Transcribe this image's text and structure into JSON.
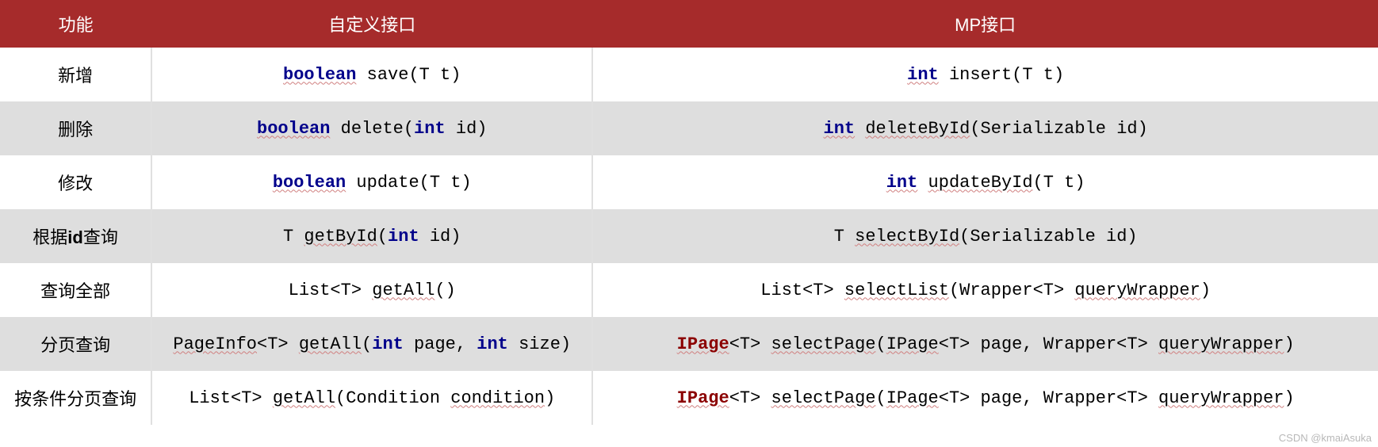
{
  "headers": {
    "col1": "功能",
    "col2": "自定义接口",
    "col3": "MP接口"
  },
  "rows": [
    {
      "feature": "新增",
      "custom": {
        "frag1": "boolean",
        "frag2": " save(T t)"
      },
      "mp": {
        "frag1": "int",
        "frag2": " insert(T t)"
      }
    },
    {
      "feature": "删除",
      "custom": {
        "frag1": "boolean",
        "frag2": " delete(",
        "frag3": "int",
        "frag4": " id)"
      },
      "mp": {
        "frag1": "int",
        "frag2": " ",
        "frag3": "deleteById",
        "frag4": "(Serializable id)"
      }
    },
    {
      "feature": "修改",
      "custom": {
        "frag1": "boolean",
        "frag2": " update(T t)"
      },
      "mp": {
        "frag1": "int",
        "frag2": " ",
        "frag3": "updateById",
        "frag4": "(T t)"
      }
    },
    {
      "feature_prefix": "根据",
      "feature_bold": "id",
      "feature_suffix": "查询",
      "custom": {
        "frag1": "T ",
        "frag2": "getById",
        "frag3": "(",
        "frag4": "int",
        "frag5": " id)"
      },
      "mp": {
        "frag1": "T ",
        "frag2": "selectById",
        "frag3": "(Serializable id)"
      }
    },
    {
      "feature": "查询全部",
      "custom": {
        "frag1": "List<T> ",
        "frag2": "getAll",
        "frag3": "()"
      },
      "mp": {
        "frag1": "List<T> ",
        "frag2": "selectList",
        "frag3": "(Wrapper<T> ",
        "frag4": "queryWrapper",
        "frag5": ")"
      }
    },
    {
      "feature": "分页查询",
      "custom": {
        "frag1": "PageInfo",
        "frag2": "<T> ",
        "frag3": "getAll",
        "frag4": "(",
        "frag5": "int",
        "frag6": " page, ",
        "frag7": "int",
        "frag8": " size)"
      },
      "mp": {
        "frag1": "IPage",
        "frag2": "<T> ",
        "frag3": "selectPage",
        "frag4": "(",
        "frag5": "IPage",
        "frag6": "<T> page, Wrapper<T> ",
        "frag7": "queryWrapper",
        "frag8": ")"
      }
    },
    {
      "feature": "按条件分页查询",
      "custom": {
        "frag1": "List<T> ",
        "frag2": "getAll",
        "frag3": "(Condition ",
        "frag4": "condition",
        "frag5": ")"
      },
      "mp": {
        "frag1": "IPage",
        "frag2": "<T> ",
        "frag3": "selectPage",
        "frag4": "(",
        "frag5": "IPage",
        "frag6": "<T> page, Wrapper<T> ",
        "frag7": "queryWrapper",
        "frag8": ")"
      }
    }
  ],
  "watermark": "CSDN @kmaiAsuka"
}
